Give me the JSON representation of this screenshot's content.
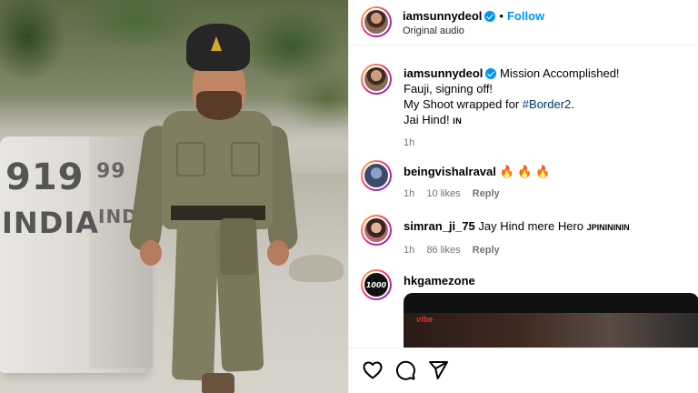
{
  "post": {
    "username": "iamsunnydeol",
    "follow_label": "Follow",
    "separator": "•",
    "subtitle": "Original audio",
    "more_label": "···"
  },
  "caption": {
    "username": "iamsunnydeol",
    "line1": "Mission Accomplished!",
    "line2": "Fauji, signing off!",
    "line3_prefix": "My Shoot wrapped for ",
    "hashtag": "#Border2",
    "line3_suffix": ".",
    "line4_prefix": "Jai Hind! ",
    "line4_flag": "IN",
    "time": "1h"
  },
  "comments": [
    {
      "username": "beingvishalraval",
      "text": "🔥 🔥 🔥",
      "time": "1h",
      "likes": "10 likes",
      "reply": "Reply"
    },
    {
      "username": "simran_ji_75",
      "text": "Jay Hind mere Hero ",
      "text_suffix": "JPININININ",
      "time": "1h",
      "likes": "86 likes",
      "reply": "Reply"
    },
    {
      "username": "hkgamezone",
      "avatar_text": "1000"
    }
  ],
  "media": {
    "stone_number": "919",
    "stone_name": "INDIA",
    "stone_number_side": "99",
    "stone_name_side": "INDIA"
  },
  "video_logo": "vibe",
  "icons": {
    "like": "heart-icon",
    "comment": "comment-icon",
    "share": "share-icon"
  },
  "colors": {
    "follow": "#0095f6",
    "verified": "#0095f6",
    "hashtag": "#00376b",
    "meta": "#737373"
  }
}
